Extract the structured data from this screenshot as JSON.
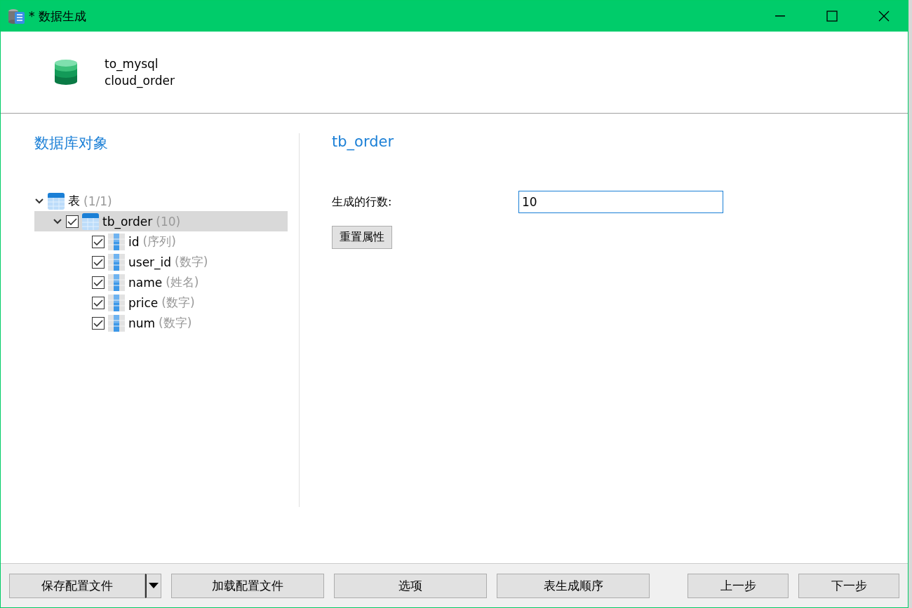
{
  "window": {
    "title": "* 数据生成"
  },
  "header": {
    "lines": [
      "to_mysql",
      "cloud_order"
    ]
  },
  "objects_panel": {
    "heading": "数据库对象",
    "tree": [
      {
        "label": "表",
        "count": "(1/1)",
        "expanded": true,
        "selected": false,
        "children": [
          {
            "label": "tb_order",
            "count": "(10)",
            "expanded": true,
            "checked": true,
            "selected": true,
            "children": [
              {
                "label": "id",
                "hint": "(序列)",
                "checked": true,
                "selected": false
              },
              {
                "label": "user_id",
                "hint": "(数字)",
                "checked": true,
                "selected": false
              },
              {
                "label": "name",
                "hint": "(姓名)",
                "checked": true,
                "selected": false
              },
              {
                "label": "price",
                "hint": "(数字)",
                "checked": true,
                "selected": false
              },
              {
                "label": "num",
                "hint": "(数字)",
                "checked": true,
                "selected": false
              }
            ]
          }
        ]
      }
    ]
  },
  "detail_panel": {
    "heading": "tb_order",
    "row_count_label": "生成的行数:",
    "row_count_value": "10",
    "reset_button": "重置属性"
  },
  "footer": {
    "left_buttons": [
      {
        "label": "保存配置文件",
        "kind": "split"
      },
      {
        "label": "加载配置文件",
        "kind": "plain"
      },
      {
        "label": "选项",
        "kind": "plain"
      },
      {
        "label": "表生成顺序",
        "kind": "plain"
      }
    ],
    "right_buttons": [
      {
        "label": "上一步",
        "kind": "plain"
      },
      {
        "label": "下一步",
        "kind": "plain"
      }
    ]
  }
}
